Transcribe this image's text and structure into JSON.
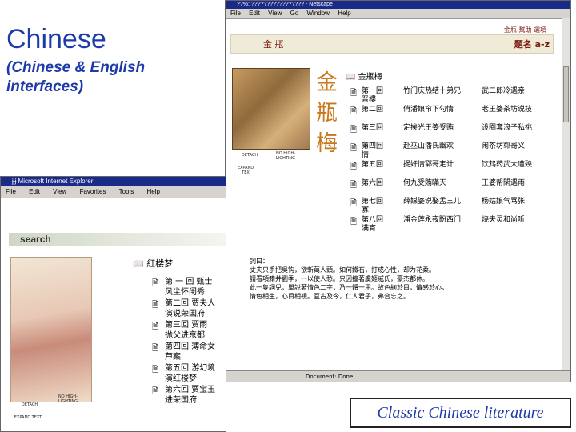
{
  "slide": {
    "title": "Chinese",
    "subtitle": "(Chinese & English interfaces)",
    "caption": "Classic Chinese literature"
  },
  "netscape": {
    "window_title": "??%: ????????????????? - Netscape",
    "menu": [
      "File",
      "Edit",
      "View",
      "Go",
      "Window",
      "Help"
    ],
    "top_links": "金瓶  幫助  選項",
    "nav_title": "金 瓶",
    "sort_label": "題名 a-z",
    "calligraphy": "金瓶梅",
    "list_heading": "金瓶梅",
    "chapters": [
      {
        "a": "第一回 晋樓",
        "b": "竹门庆热结十弟兄",
        "c": "武二郎冷遇亲"
      },
      {
        "a": "第二回",
        "b": "俏潘娘帘下勾情",
        "c": "老王婆茶坊说技"
      },
      {
        "a": "第三回",
        "b": "定挨光王婆受贿",
        "c": "设圈套浪子私挑"
      },
      {
        "a": "第四回 情",
        "b": "赴巫山潘氏幽欢",
        "c": "闹茶坊郓哥义"
      },
      {
        "a": "第五回",
        "b": "捉奸情郓哥定计",
        "c": "饮鸩药武大遭殃"
      },
      {
        "a": "第六回",
        "b": "何九受賄瞞天",
        "c": "王婆帮閑遇雨"
      },
      {
        "a": "第七回 寡",
        "b": "薛媒婆说娶孟三儿",
        "c": "杨姑娘气骂张"
      },
      {
        "a": "第八回 满宵",
        "b": "潘金莲永夜盼西门",
        "c": "烧夫灵和尚听"
      }
    ],
    "preface_label": "詞曰：",
    "preface_lines": [
      "丈夫只手把吳钩，欲斬萬人頭。如何鐵石，打成心性，却为花柔。",
      "請看項籍并劉季，一以使人愁。只因撞著虞姬戚氏，豪杰都休。",
      "此一隻詞兒，單說著情色二字，乃一體一用。故色絢於目，情感於心，",
      "情色相生，心目相視。亘古及今，仁人君子，弗合忘之。"
    ],
    "status": "Document: Done",
    "detach": "DETACH",
    "no_highlighting": "NO HIGH-LIGHTING",
    "expand_text": "EXPAND TEX"
  },
  "ie": {
    "window_title": "ɉɉɉ Microsoft Internet Explorer",
    "menu": [
      "File",
      "Edit",
      "View",
      "Favorites",
      "Tools",
      "Help"
    ],
    "search": "search",
    "list_heading": "紅楼梦",
    "items": [
      {
        "a": "第 一 回",
        "b": "甄士",
        "line2": "风尘怀闺秀"
      },
      {
        "a": "第二回",
        "b": "贾夫人",
        "line2": "演说荣国府"
      },
      {
        "a": "第三回",
        "b": "贾雨",
        "line2": "抛父进京都"
      },
      {
        "a": "第四回",
        "b": "薄命女",
        "line2": "芦案"
      },
      {
        "a": "第五回",
        "b": "游幻境",
        "line2": "演红楼梦"
      },
      {
        "a": "第六回",
        "b": "贾宝玉",
        "line2": "进荣国府"
      }
    ],
    "detach": "DETACH",
    "no_highlighting": "NO HIGH-LIGHTING",
    "expand_text": "EXPAND TEXT"
  }
}
